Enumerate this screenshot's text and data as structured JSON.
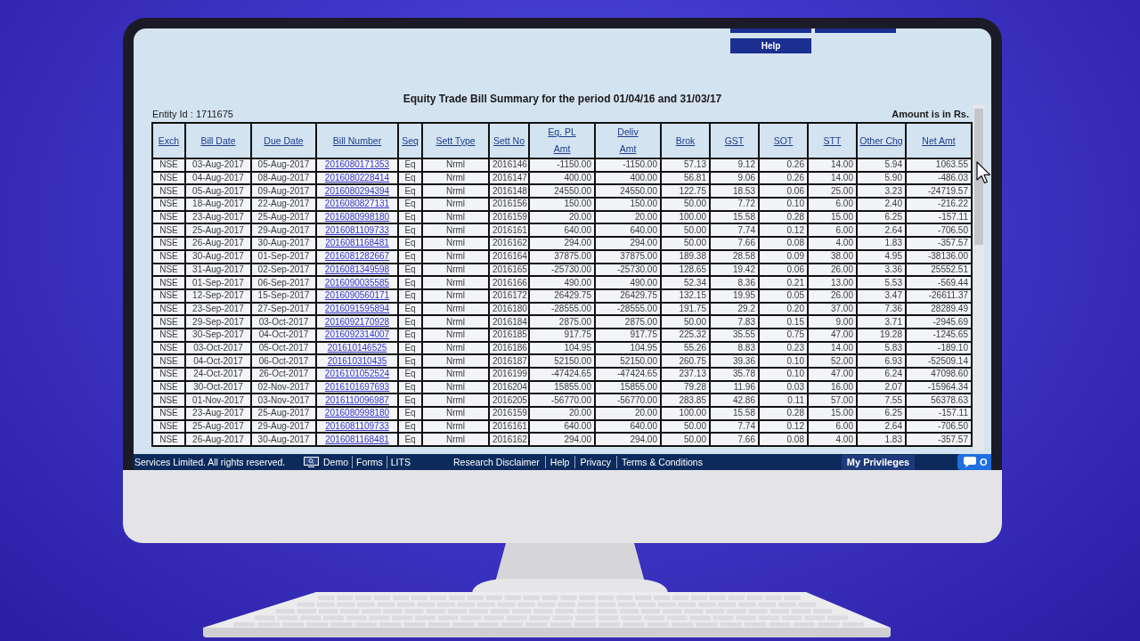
{
  "screen": {
    "cropped_buttons": [
      {
        "kind": "cropped"
      },
      {
        "kind": "cropped"
      }
    ],
    "help_button": "Help",
    "title": "Equity Trade Bill Summary for the period 01/04/16 and 31/03/17",
    "entity_id": "Entity Id : 1711675",
    "amount_note": "Amount is in Rs.",
    "table": {
      "columns": [
        {
          "lines": [
            "Exch"
          ],
          "kind": "text"
        },
        {
          "lines": [
            "Bill Date"
          ],
          "kind": "text"
        },
        {
          "lines": [
            "Due Date"
          ],
          "kind": "text"
        },
        {
          "lines": [
            "Bill Number"
          ],
          "kind": "link"
        },
        {
          "lines": [
            "Seq"
          ],
          "kind": "text"
        },
        {
          "lines": [
            "Sett Type"
          ],
          "kind": "text"
        },
        {
          "lines": [
            "Sett No"
          ],
          "kind": "number"
        },
        {
          "lines": [
            "Eq. PL",
            "Amt"
          ],
          "kind": "number"
        },
        {
          "lines": [
            "Deliv",
            "Amt"
          ],
          "kind": "number"
        },
        {
          "lines": [
            "Brok"
          ],
          "kind": "number"
        },
        {
          "lines": [
            "GST"
          ],
          "kind": "number"
        },
        {
          "lines": [
            "SOT"
          ],
          "kind": "number"
        },
        {
          "lines": [
            "STT"
          ],
          "kind": "number"
        },
        {
          "lines": [
            "Other Chg"
          ],
          "kind": "number"
        },
        {
          "lines": [
            "Net Amt"
          ],
          "kind": "number"
        }
      ],
      "rows": [
        [
          "NSE",
          "03-Aug-2017",
          "05-Aug-2017",
          "2016080171353",
          "Eq",
          "Nrml",
          "2016146",
          "-1150.00",
          "-1150.00",
          "57.13",
          "9.12",
          "0.26",
          "14.00",
          "5.94",
          "1063.55"
        ],
        [
          "NSE",
          "04-Aug-2017",
          "08-Aug-2017",
          "2016080228414",
          "Eq",
          "Nrml",
          "2016147",
          "400.00",
          "400.00",
          "56.81",
          "9.06",
          "0.26",
          "14.00",
          "5.90",
          "-486.03"
        ],
        [
          "NSE",
          "05-Aug-2017",
          "09-Aug-2017",
          "2016080294394",
          "Eq",
          "Nrml",
          "2016148",
          "24550.00",
          "24550.00",
          "122.75",
          "18.53",
          "0.06",
          "25.00",
          "3.23",
          "-24719.57"
        ],
        [
          "NSE",
          "18-Aug-2017",
          "22-Aug-2017",
          "2016080827131",
          "Eq",
          "Nrml",
          "2016156",
          "150.00",
          "150.00",
          "50.00",
          "7.72",
          "0.10",
          "6.00",
          "2.40",
          "-216.22"
        ],
        [
          "NSE",
          "23-Aug-2017",
          "25-Aug-2017",
          "2016080998180",
          "Eq",
          "Nrml",
          "2016159",
          "20.00",
          "20.00",
          "100.00",
          "15.58",
          "0.28",
          "15.00",
          "6.25",
          "-157.11"
        ],
        [
          "NSE",
          "25-Aug-2017",
          "29-Aug-2017",
          "2016081109733",
          "Eq",
          "Nrml",
          "2016161",
          "640.00",
          "640.00",
          "50.00",
          "7.74",
          "0.12",
          "6.00",
          "2.64",
          "-706.50"
        ],
        [
          "NSE",
          "26-Aug-2017",
          "30-Aug-2017",
          "2016081168481",
          "Eq",
          "Nrml",
          "2016162",
          "294.00",
          "294.00",
          "50.00",
          "7.66",
          "0.08",
          "4.00",
          "1.83",
          "-357.57"
        ],
        [
          "NSE",
          "30-Aug-2017",
          "01-Sep-2017",
          "2016081282667",
          "Eq",
          "Nrml",
          "2016164",
          "37875.00",
          "37875.00",
          "189.38",
          "28.58",
          "0.09",
          "38.00",
          "4.95",
          "-38136.00"
        ],
        [
          "NSE",
          "31-Aug-2017",
          "02-Sep-2017",
          "2016081349598",
          "Eq",
          "Nrml",
          "2016165",
          "-25730.00",
          "-25730.00",
          "128.65",
          "19.42",
          "0.06",
          "26.00",
          "3.36",
          "25552.51"
        ],
        [
          "NSE",
          "01-Sep-2017",
          "06-Sep-2017",
          "2016090035585",
          "Eq",
          "Nrml",
          "2016166",
          "490.00",
          "490.00",
          "52.34",
          "8.36",
          "0.21",
          "13.00",
          "5.53",
          "-569.44"
        ],
        [
          "NSE",
          "12-Sep-2017",
          "15-Sep-2017",
          "2016090560171",
          "Eq",
          "Nrml",
          "2016172",
          "26429.75",
          "26429.75",
          "132.15",
          "19.95",
          "0.05",
          "26.00",
          "3.47",
          "-26611.37"
        ],
        [
          "NSE",
          "23-Sep-2017",
          "27-Sep-2017",
          "2016091595894",
          "Eq",
          "Nrml",
          "2016180",
          "-28555.00",
          "-28555.00",
          "191.75",
          "29.2",
          "0.20",
          "37.00",
          "7.36",
          "28289.49"
        ],
        [
          "NSE",
          "29-Sep-2017",
          "03-Oct-2017",
          "2016092170928",
          "Eq",
          "Nrml",
          "2016184",
          "2875.00",
          "2875.00",
          "50.00",
          "7.83",
          "0.15",
          "9.00",
          "3.71",
          "-2945.69"
        ],
        [
          "NSE",
          "30-Sep-2017",
          "04-Oct-2017",
          "2016092314007",
          "Eq",
          "Nrml",
          "2016185",
          "917.75",
          "917.75",
          "225.32",
          "35.55",
          "0.75",
          "47.00",
          "19.28",
          "-1245.65"
        ],
        [
          "NSE",
          "03-Oct-2017",
          "05-Oct-2017",
          "201610146525",
          "Eq",
          "Nrml",
          "2016186",
          "104.95",
          "104.95",
          "55.26",
          "8.83",
          "0.23",
          "14.00",
          "5.83",
          "-189.10"
        ],
        [
          "NSE",
          "04-Oct-2017",
          "06-Oct-2017",
          "201610310435",
          "Eq",
          "Nrml",
          "2016187",
          "52150.00",
          "52150.00",
          "260.75",
          "39.36",
          "0.10",
          "52.00",
          "6.93",
          "-52509.14"
        ],
        [
          "NSE",
          "24-Oct-2017",
          "26-Oct-2017",
          "2016101052524",
          "Eq",
          "Nrml",
          "2016199",
          "-47424.65",
          "-47424.65",
          "237.13",
          "35.78",
          "0.10",
          "47.00",
          "6.24",
          "47098.60"
        ],
        [
          "NSE",
          "30-Oct-2017",
          "02-Nov-2017",
          "2016101697693",
          "Eq",
          "Nrml",
          "2016204",
          "15855.00",
          "15855.00",
          "79.28",
          "11.96",
          "0.03",
          "16.00",
          "2.07",
          "-15964.34"
        ],
        [
          "NSE",
          "01-Nov-2017",
          "03-Nov-2017",
          "2016110096987",
          "Eq",
          "Nrml",
          "2016205",
          "-56770.00",
          "-56770.00",
          "283.85",
          "42.86",
          "0.11",
          "57.00",
          "7.55",
          "56378.63"
        ],
        [
          "NSE",
          "23-Aug-2017",
          "25-Aug-2017",
          "2016080998180",
          "Eq",
          "Nrml",
          "2016159",
          "20.00",
          "20.00",
          "100.00",
          "15.58",
          "0.28",
          "15.00",
          "6.25",
          "-157.11"
        ],
        [
          "NSE",
          "25-Aug-2017",
          "29-Aug-2017",
          "2016081109733",
          "Eq",
          "Nrml",
          "2016161",
          "640.00",
          "640.00",
          "50.00",
          "7.74",
          "0.12",
          "6.00",
          "2.64",
          "-706.50"
        ],
        [
          "NSE",
          "26-Aug-2017",
          "30-Aug-2017",
          "2016081168481",
          "Eq",
          "Nrml",
          "2016162",
          "294.00",
          "294.00",
          "50.00",
          "7.66",
          "0.08",
          "4.00",
          "1.83",
          "-357.57"
        ]
      ]
    },
    "footer": {
      "copyright": "Services Limited. All rights reserved.",
      "link_groups": [
        [
          {
            "label": "Demo",
            "kind": "icon"
          },
          {
            "label": "Forms",
            "kind": "plain"
          },
          {
            "label": "LITS",
            "kind": "plain"
          }
        ],
        [
          {
            "label": "Research Disclaimer",
            "kind": "plain"
          },
          {
            "label": "Help",
            "kind": "plain"
          },
          {
            "label": "Privacy",
            "kind": "plain"
          },
          {
            "label": "Terms & Conditions",
            "kind": "plain"
          }
        ]
      ],
      "privileges_button": "My Privileges",
      "chat_label": "O"
    }
  }
}
